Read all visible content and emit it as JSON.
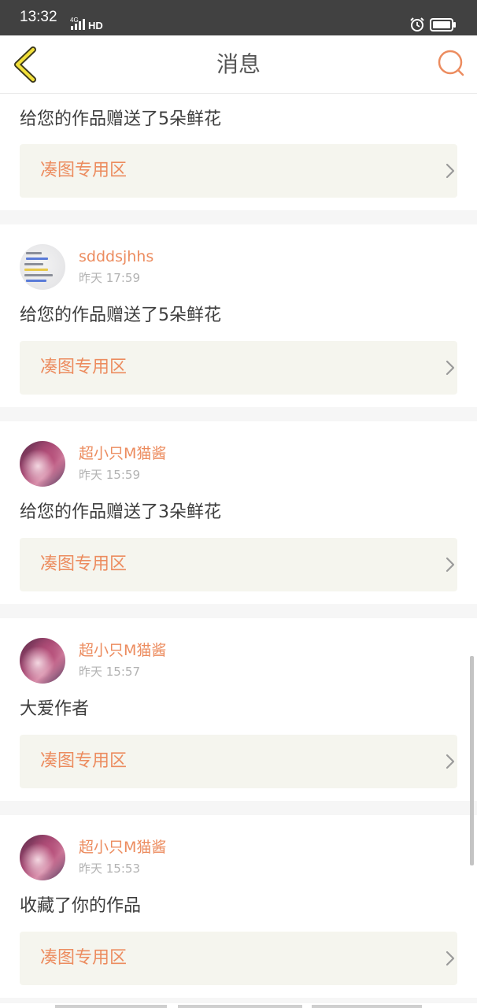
{
  "status_bar": {
    "time": "13:32",
    "network": "4G",
    "hd": "HD"
  },
  "header": {
    "title": "消息",
    "accent_color": "#ec8c5f"
  },
  "messages": [
    {
      "text": "给您的作品赠送了5朵鲜花",
      "link_label": "凑图专用区"
    },
    {
      "user": "sdddsjhhs",
      "time": "昨天 17:59",
      "text": "给您的作品赠送了5朵鲜花",
      "link_label": "凑图专用区"
    },
    {
      "user": "超小只M猫酱",
      "time": "昨天 15:59",
      "text": "给您的作品赠送了3朵鲜花",
      "link_label": "凑图专用区"
    },
    {
      "user": "超小只M猫酱",
      "time": "昨天 15:57",
      "text": "大爱作者",
      "link_label": "凑图专用区"
    },
    {
      "user": "超小只M猫酱",
      "time": "昨天 15:53",
      "text": "收藏了你的作品",
      "link_label": "凑图专用区"
    }
  ]
}
